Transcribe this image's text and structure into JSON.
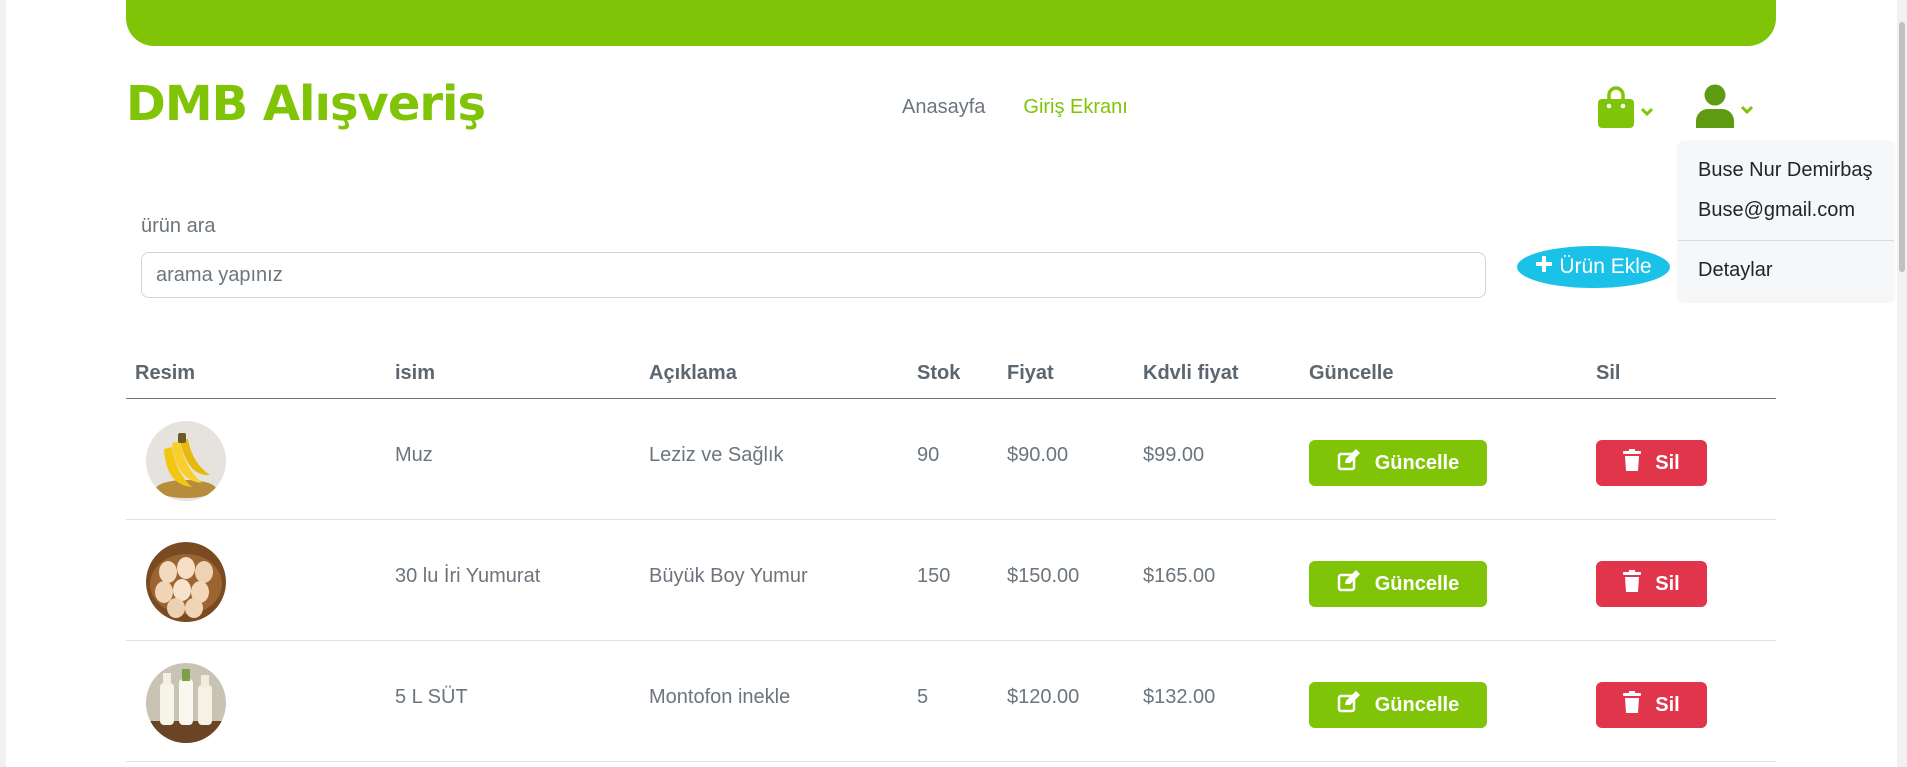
{
  "brand": {
    "name": "DMB Alışveriş",
    "color": "#7fc406"
  },
  "nav": {
    "home": "Anasayfa",
    "login": "Giriş Ekranı"
  },
  "header_icons": {
    "cart": "shopping-bag-icon",
    "user": "user-icon",
    "chevron": "chevron-down-icon"
  },
  "user_menu": {
    "name": "Buse Nur Demirbaş",
    "email": "Buse@gmail.com",
    "details": "Detaylar"
  },
  "search": {
    "label": "ürün ara",
    "placeholder": "arama yapınız",
    "value": ""
  },
  "add_button": {
    "label": "Ürün Ekle",
    "icon": "plus-icon",
    "color": "#19c2e6"
  },
  "table": {
    "headers": {
      "image": "Resim",
      "name": "isim",
      "description": "Açıklama",
      "stock": "Stok",
      "price": "Fiyat",
      "price_vat": "Kdvli fiyat",
      "update": "Güncelle",
      "delete": "Sil"
    },
    "rows": [
      {
        "image": "banana-image",
        "name": "Muz",
        "description": "Leziz ve Sağlık",
        "stock": "90",
        "price": "$90.00",
        "price_vat": "$99.00",
        "update_label": "Güncelle",
        "delete_label": "Sil"
      },
      {
        "image": "eggs-image",
        "name": "30 lu İri Yumurat",
        "description": "Büyük Boy Yumur",
        "stock": "150",
        "price": "$150.00",
        "price_vat": "$165.00",
        "update_label": "Güncelle",
        "delete_label": "Sil"
      },
      {
        "image": "milk-bottles-image",
        "name": "5 L SÜT",
        "description": "Montofon inekle",
        "stock": "5",
        "price": "$120.00",
        "price_vat": "$132.00",
        "update_label": "Güncelle",
        "delete_label": "Sil"
      }
    ]
  },
  "colors": {
    "update": "#7fc406",
    "delete": "#e0354a",
    "text": "#6c757d"
  }
}
